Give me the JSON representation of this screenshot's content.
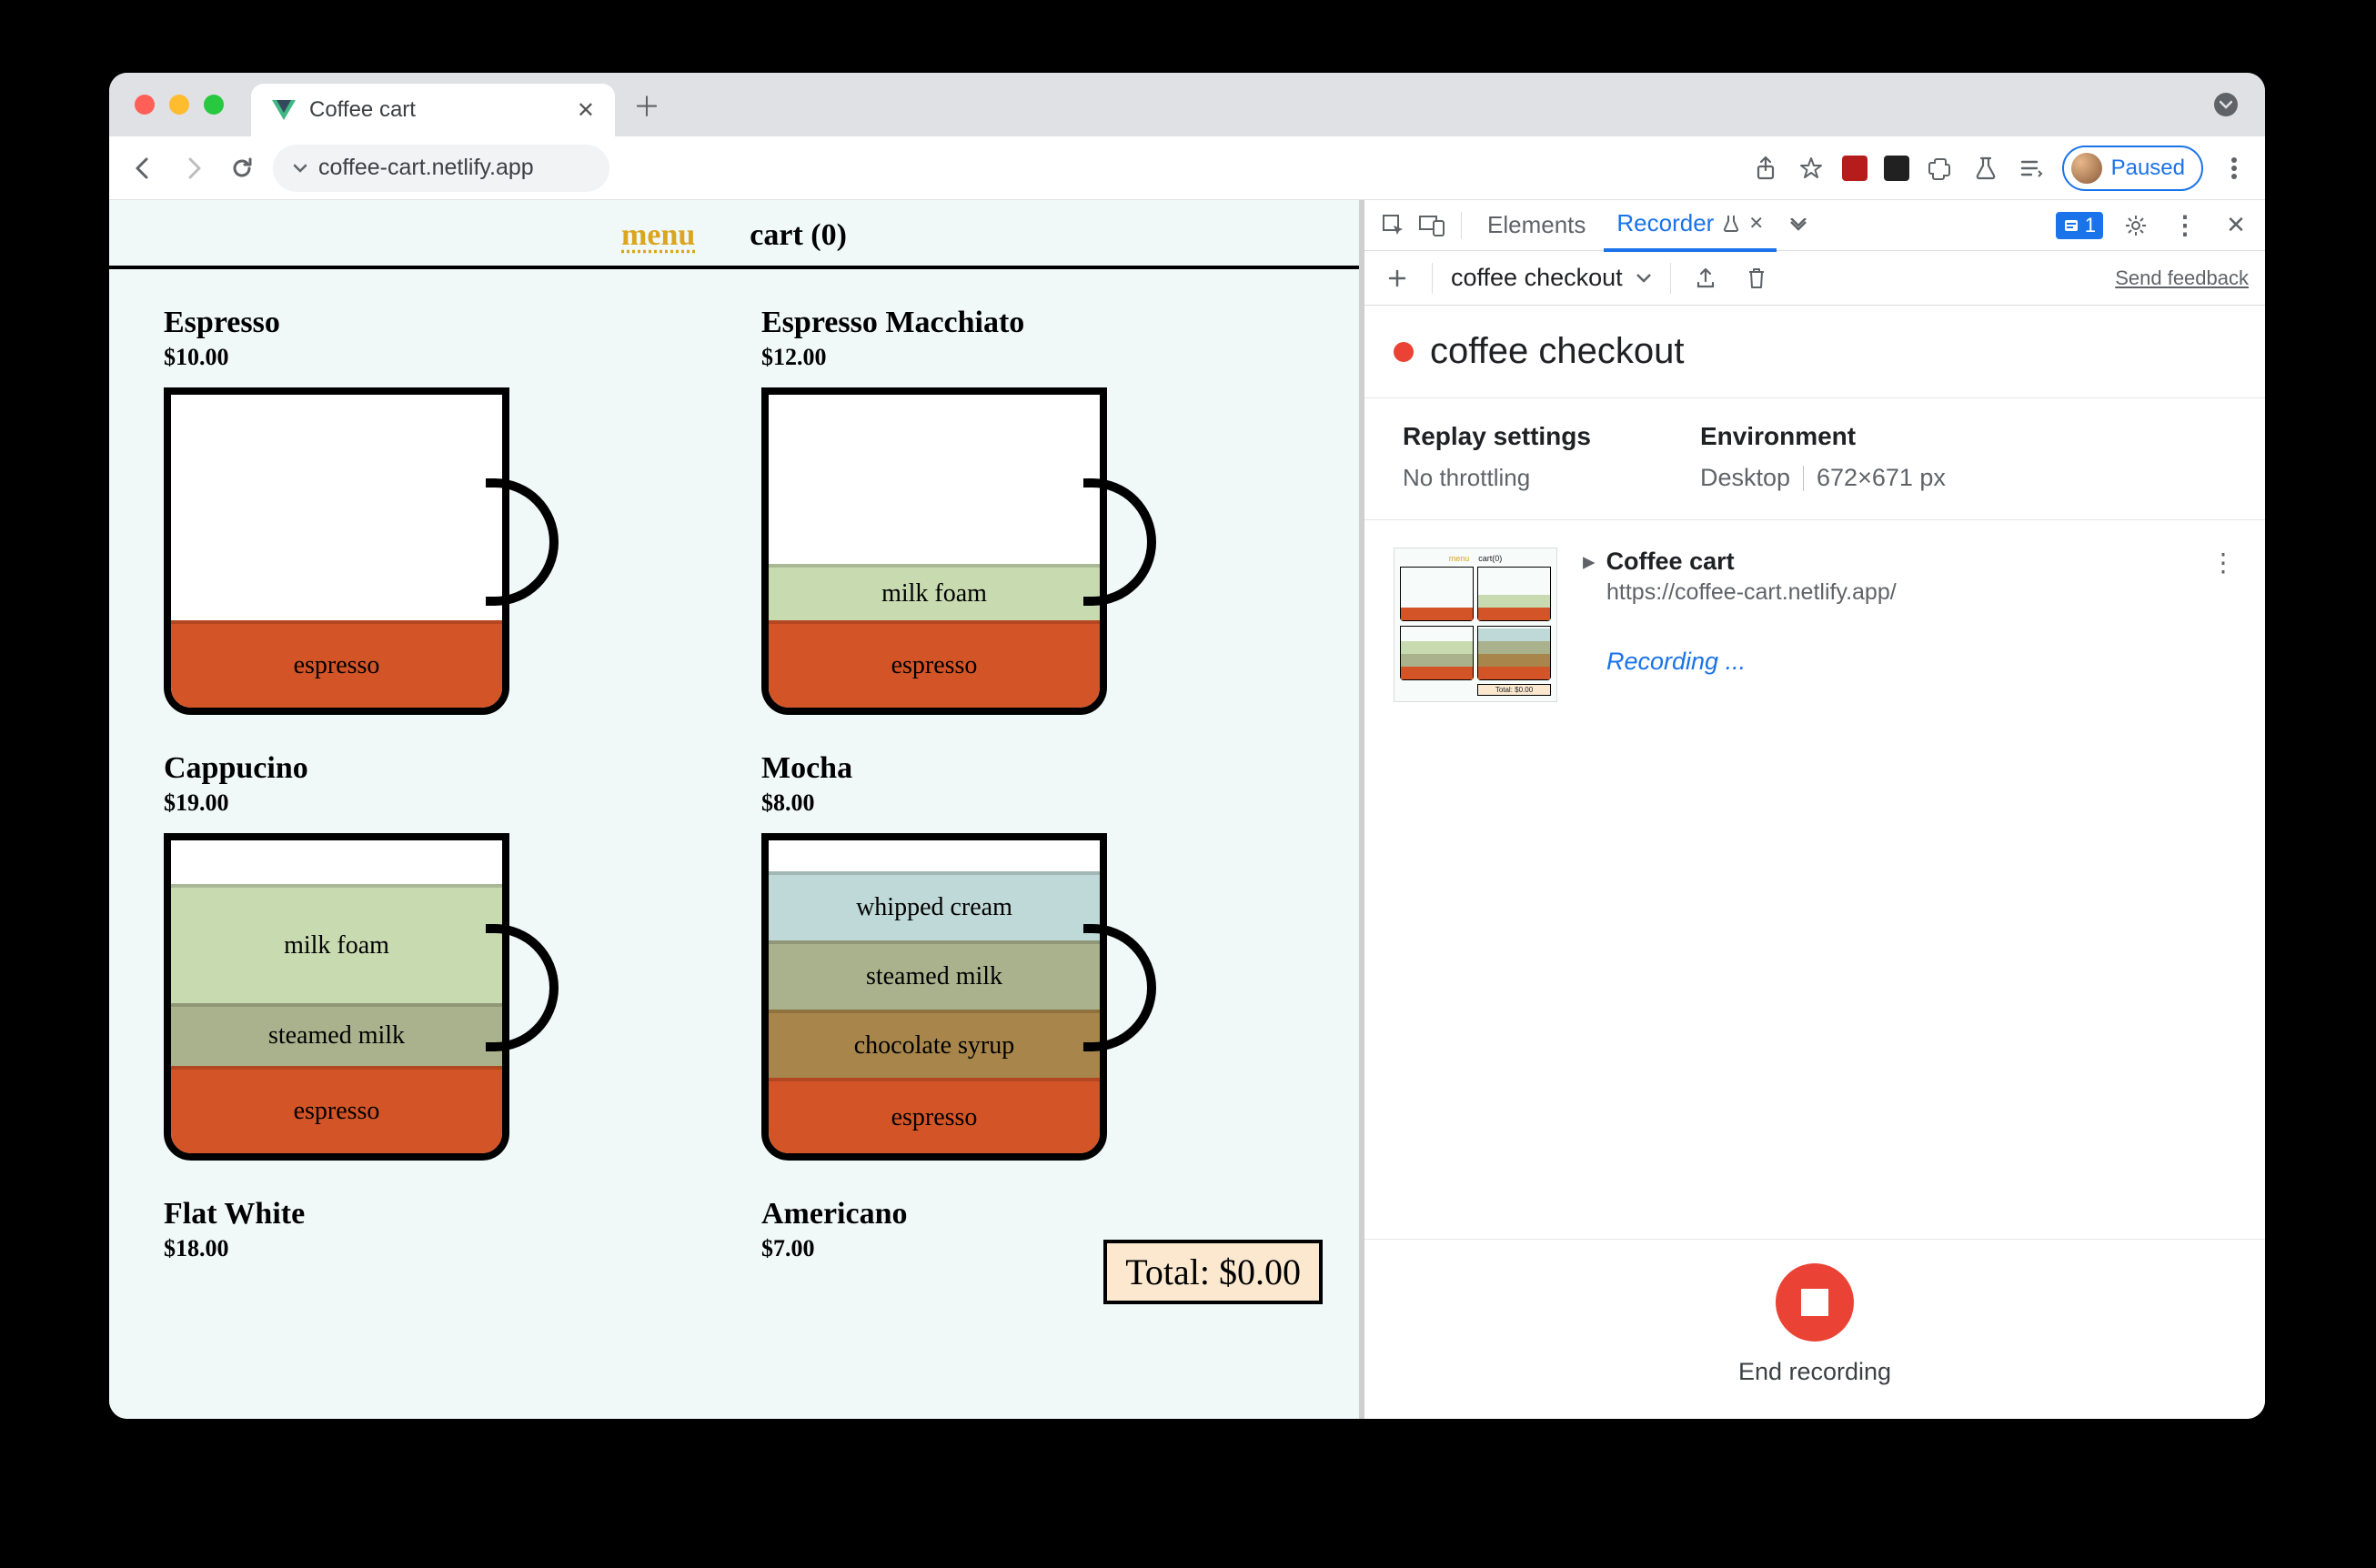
{
  "browser": {
    "tab_title": "Coffee cart",
    "url": "coffee-cart.netlify.app",
    "paused_label": "Paused"
  },
  "page": {
    "nav": {
      "menu": "menu",
      "cart": "cart (0)"
    },
    "items": [
      {
        "name": "Espresso",
        "price": "$10.00"
      },
      {
        "name": "Espresso Macchiato",
        "price": "$12.00"
      },
      {
        "name": "Cappucino",
        "price": "$19.00"
      },
      {
        "name": "Mocha",
        "price": "$8.00"
      },
      {
        "name": "Flat White",
        "price": "$18.00"
      },
      {
        "name": "Americano",
        "price": "$7.00"
      }
    ],
    "layers": {
      "espresso": "espresso",
      "milk_foam": "milk foam",
      "steamed_milk": "steamed milk",
      "chocolate_syrup": "chocolate syrup",
      "whipped_cream": "whipped cream"
    },
    "total": "Total: $0.00"
  },
  "devtools": {
    "tabs": {
      "elements": "Elements",
      "recorder": "Recorder"
    },
    "issues_count": "1",
    "toolbar": {
      "flow_name": "coffee checkout",
      "send_feedback": "Send feedback"
    },
    "heading": "coffee checkout",
    "settings": {
      "replay_title": "Replay settings",
      "replay_value": "No throttling",
      "env_title": "Environment",
      "env_device": "Desktop",
      "env_dims": "672×671 px"
    },
    "step": {
      "title": "Coffee cart",
      "url": "https://coffee-cart.netlify.app/",
      "recording": "Recording ..."
    },
    "footer": {
      "end": "End recording"
    }
  }
}
